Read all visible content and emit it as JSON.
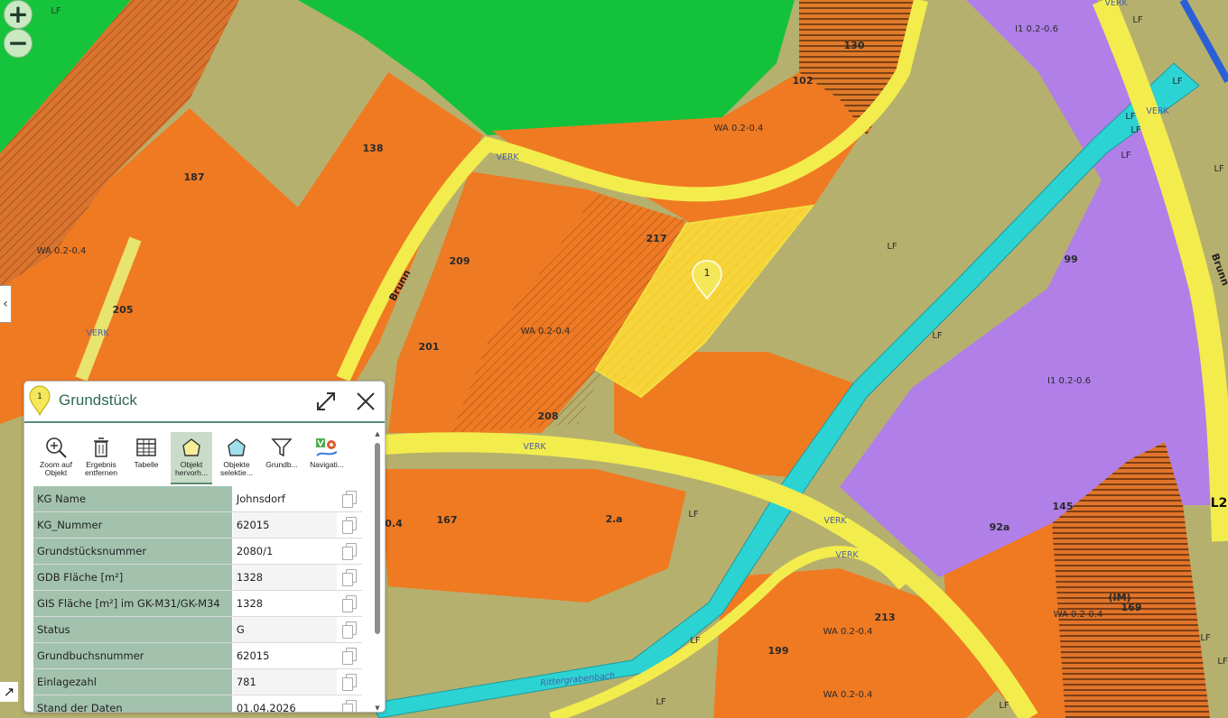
{
  "map": {
    "labels": {
      "lf_topleft": "LF",
      "p130": "130",
      "p102": "102",
      "p138": "138",
      "p187": "187",
      "p205": "205",
      "p209": "209",
      "p217": "217",
      "p201": "201",
      "p208": "208",
      "p167": "167",
      "p2a": "2․a",
      "p99": "99",
      "p145": "145",
      "p92a": "92a",
      "p213": "213",
      "p199": "199",
      "p169": "169",
      "im": "(IM)",
      "p04": "0.4",
      "wa_upper": "WA 0.2-0.4",
      "wa_left": "WA 0.2-0.4",
      "wa_mid": "WA 0.2-0.4",
      "wa_right": "WA 0.2-0.4",
      "wa_bottom1": "WA 0.2-0.4",
      "wa_bottom2": "WA 0.2-0.4",
      "i1_top": "I1 0.2-0.6",
      "i1_mid": "I1 0.2-0.6",
      "lf_field": "LF",
      "lf_stream": "LF",
      "lf_blue1": "LF",
      "lf_blue2": "LF",
      "lf_blue3": "LF",
      "lf_blue4": "LF",
      "lf_r1": "LF",
      "lf_r2": "LF",
      "lf_r3": "LF",
      "lf_b1": "LF",
      "lf_b2": "LF",
      "lf_b3": "LF",
      "lf_b4": "LF",
      "lf_c1": "LF",
      "verk1": "VERK",
      "verk2": "VERK",
      "verk3": "VERK",
      "verk4": "VERK",
      "verk5": "VERK",
      "verk6": "VERK",
      "verk7": "VERK",
      "verk_top": "VERK",
      "brunn": "Brunn",
      "brunn_right": "Brunn",
      "l2": "L2",
      "stream": "Rittergrabenbach",
      "marker": "1"
    },
    "colors": {
      "green": "#12c93a",
      "orange": "#f07b1f",
      "purple": "#b080e6",
      "yellow": "#f6ef4a",
      "cyan": "#2bd0d0",
      "field": "#b9b270",
      "highlight": "#f6d23a"
    }
  },
  "controls": {
    "zoom_in": "+",
    "zoom_out": "−",
    "panel_toggle": "‹",
    "expand": "↗"
  },
  "popup": {
    "title": "Grundstück",
    "marker_number": "1",
    "toolbar": [
      {
        "label_line1": "Zoom auf",
        "label_line2": "Objekt",
        "icon": "zoom-icon"
      },
      {
        "label_line1": "Ergebnis",
        "label_line2": "entfernen",
        "icon": "trash-icon"
      },
      {
        "label_line1": "Tabelle",
        "label_line2": "",
        "icon": "table-icon"
      },
      {
        "label_line1": "Objekt",
        "label_line2": "hervorh...",
        "icon": "highlight-object-icon"
      },
      {
        "label_line1": "Objekte",
        "label_line2": "selektie...",
        "icon": "select-objects-icon"
      },
      {
        "label_line1": "Grundb...",
        "label_line2": "",
        "icon": "filter-icon"
      },
      {
        "label_line1": "Navigati...",
        "label_line2": "",
        "icon": "navigation-icon"
      }
    ],
    "rows": [
      {
        "key": "KG Name",
        "value": "Johnsdorf"
      },
      {
        "key": "KG_Nummer",
        "value": "62015"
      },
      {
        "key": "Grundstücksnummer",
        "value": "2080/1"
      },
      {
        "key": "GDB Fläche [m²]",
        "value": "1328"
      },
      {
        "key": "GIS Fläche [m²] im GK-M31/GK-M34",
        "value": "1328"
      },
      {
        "key": "Status",
        "value": "G"
      },
      {
        "key": "Grundbuchsnummer",
        "value": "62015"
      },
      {
        "key": "Einlagezahl",
        "value": "781"
      },
      {
        "key": "Stand der Daten",
        "value": "01.04.2026"
      }
    ]
  }
}
